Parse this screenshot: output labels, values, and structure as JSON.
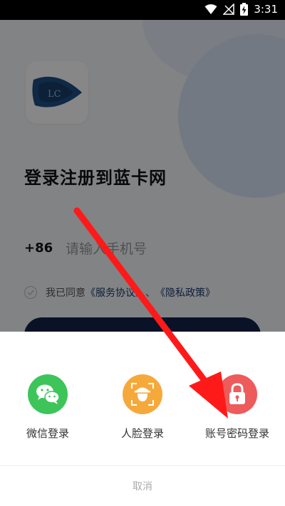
{
  "status_bar": {
    "time": "3:31"
  },
  "login": {
    "title": "登录注册到蓝卡网",
    "country_code": "+86",
    "phone_placeholder": "请输入手机号",
    "agree_prefix": "我已同意",
    "terms_link": "《服务协议》",
    "separator": "、",
    "privacy_link": "《隐私政策》"
  },
  "sheet": {
    "options": [
      {
        "label": "微信登录",
        "icon": "wechat-icon",
        "color": "#3dc55a"
      },
      {
        "label": "人脸登录",
        "icon": "face-icon",
        "color": "#f6a93b"
      },
      {
        "label": "账号密码登录",
        "icon": "lock-icon",
        "color": "#ee5b5b"
      }
    ],
    "cancel_label": "取消"
  },
  "colors": {
    "brand_dark": "#13234a",
    "arrow": "#ff1a1a"
  }
}
